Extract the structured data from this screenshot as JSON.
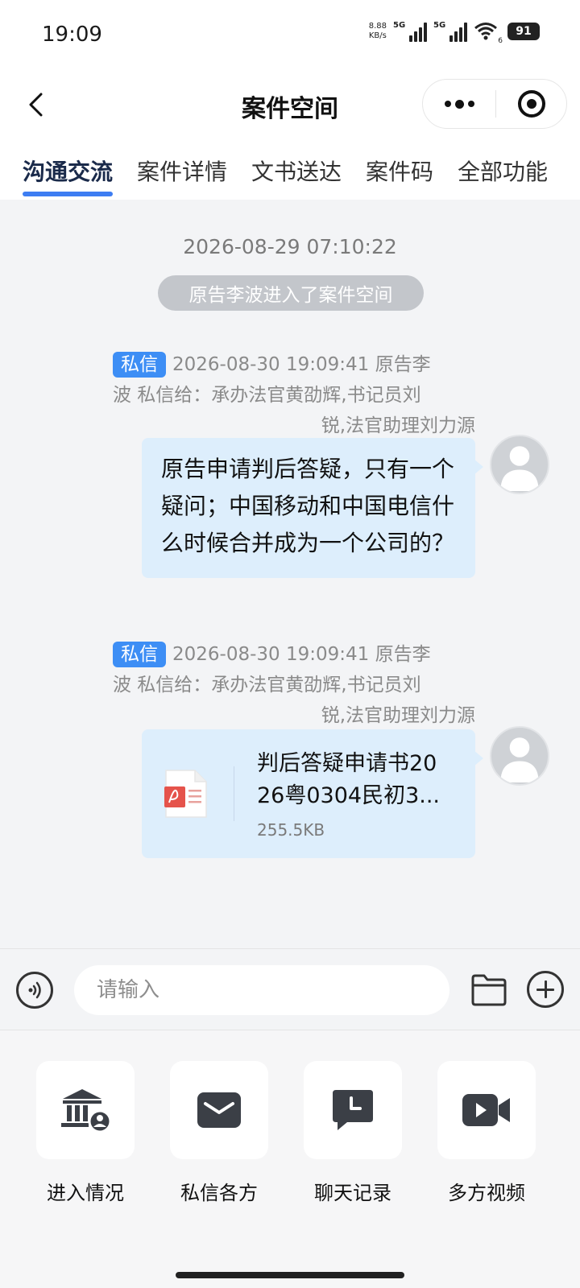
{
  "status_bar": {
    "time": "19:09",
    "net_speed_value": "8.88",
    "net_speed_unit": "KB/s",
    "sim1_label": "5G",
    "sim2_label": "5G",
    "wifi_sub": "6",
    "battery": "91"
  },
  "nav": {
    "title": "案件空间"
  },
  "tabs": [
    {
      "label": "沟通交流",
      "active": true
    },
    {
      "label": "案件详情",
      "active": false
    },
    {
      "label": "文书送达",
      "active": false
    },
    {
      "label": "案件码",
      "active": false
    },
    {
      "label": "全部功能",
      "active": false
    }
  ],
  "chat": {
    "system_time": "2026-08-29 07:10:22",
    "system_notice": "原告李波进入了案件空间",
    "messages": [
      {
        "tag": "私信",
        "meta_line1": "2026-08-30 19:09:41 原告李",
        "meta_line2": "波 私信给：承办法官黄劭辉,书记员刘",
        "meta_line3": "锐,法官助理刘力源",
        "text": "原告申请判后答疑，只有一个疑问；中国移动和中国电信什么时候合并成为一个公司的？"
      },
      {
        "tag": "私信",
        "meta_line1": "2026-08-30 19:09:41 原告李",
        "meta_line2": "波 私信给：承办法官黄劭辉,书记员刘",
        "meta_line3": "锐,法官助理刘力源",
        "file_name_line1": "判后答疑申请书20",
        "file_name_line2": "26粤0304民初3...",
        "file_size": "255.5KB"
      }
    ]
  },
  "input": {
    "placeholder": "请输入"
  },
  "functions": [
    {
      "label": "进入情况",
      "icon": "court-icon"
    },
    {
      "label": "私信各方",
      "icon": "mail-icon"
    },
    {
      "label": "聊天记录",
      "icon": "chat-history-icon"
    },
    {
      "label": "多方视频",
      "icon": "video-icon"
    }
  ],
  "colors": {
    "accent": "#3d7df2",
    "tag": "#3d8ef5",
    "bubble": "#ddeefc",
    "pdf": "#e5534b",
    "notice_bg": "#c3c6cb"
  }
}
